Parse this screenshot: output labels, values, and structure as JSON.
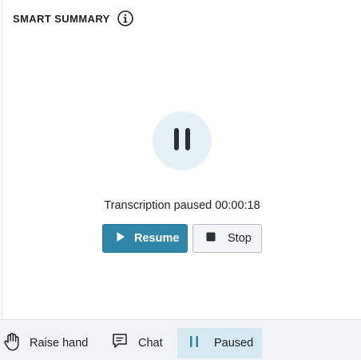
{
  "panel": {
    "title": "SMART SUMMARY",
    "info_icon": "info-circle-icon"
  },
  "transcription": {
    "status_icon": "pause-icon",
    "status_label": "Transcription paused",
    "elapsed": "00:00:18",
    "status_text": "Transcription paused 00:00:18",
    "resume_label": "Resume",
    "resume_icon": "play-icon",
    "stop_label": "Stop",
    "stop_icon": "stop-icon"
  },
  "toolbar": {
    "items": [
      {
        "label": "Raise hand",
        "icon": "hand-icon",
        "active": false
      },
      {
        "label": "Chat",
        "icon": "chat-bubble-icon",
        "active": false
      },
      {
        "label": "Paused",
        "icon": "pause-icon",
        "active": true
      }
    ]
  },
  "colors": {
    "accent": "#2f86a8",
    "status_circle_bg": "#e5f1f6",
    "active_toolbar_bg": "#d6e8f0",
    "toolbar_bg": "#f2f3f5"
  }
}
